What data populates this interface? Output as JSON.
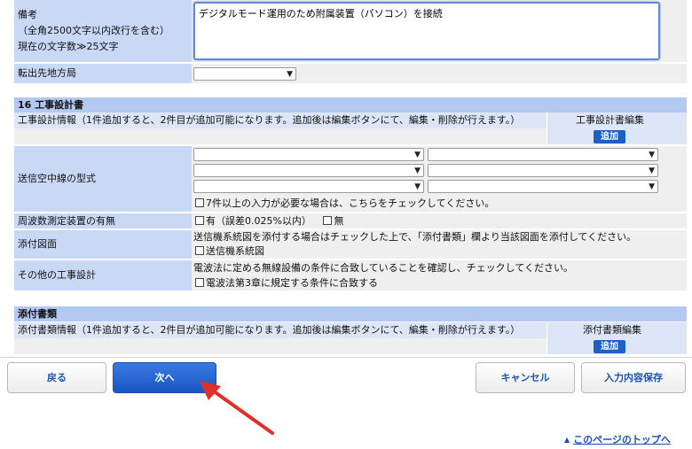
{
  "remarks": {
    "label_line1": "備考",
    "label_line2": "（全角2500文字以内改行を含む）",
    "label_line3": "現在の文字数≫25文字",
    "value": "デジタルモード運用のため附属装置（パソコン）を接続"
  },
  "transfer": {
    "label": "転出先地方局",
    "selected": ""
  },
  "section16": {
    "title": "16 工事設計書",
    "info_text": "工事設計情報（1件追加すると、2件目が追加可能になります。追加後は編集ボタンにて、編集・削除が行えます。）",
    "edit_header": "工事設計書編集",
    "add_label": "追加",
    "antenna_label": "送信空中線の型式",
    "antenna_note": "7件以上の入力が必要な場合は、こちらをチェックしてください。",
    "freq_label": "周波数測定装置の有無",
    "freq_yes": "有（誤差0.025%以内）",
    "freq_no": "無",
    "attach_label": "添付図面",
    "attach_desc": "送信機系統図を添付する場合はチェックした上で、「添付書類」欄より当該図面を添付してください。",
    "attach_check": "送信機系統図",
    "other_label": "その他の工事設計",
    "other_desc": "電波法に定める無線設備の条件に合致していることを確認し、チェックしてください。",
    "other_check": "電波法第3章に規定する条件に合致する"
  },
  "attachments": {
    "title": "添付書類",
    "info_text": "添付書類情報（1件追加すると、2件目が追加可能になります。追加後は編集ボタンにて、編集・削除が行えます。）",
    "edit_header": "添付書類編集",
    "add_label": "追加"
  },
  "nav": {
    "back": "戻る",
    "next": "次へ",
    "cancel": "キャンセル",
    "save": "入力内容保存"
  },
  "page_top": "このページのトップへ",
  "colors": {
    "accent": "#1b5fc9",
    "arrow": "#e0302a"
  }
}
